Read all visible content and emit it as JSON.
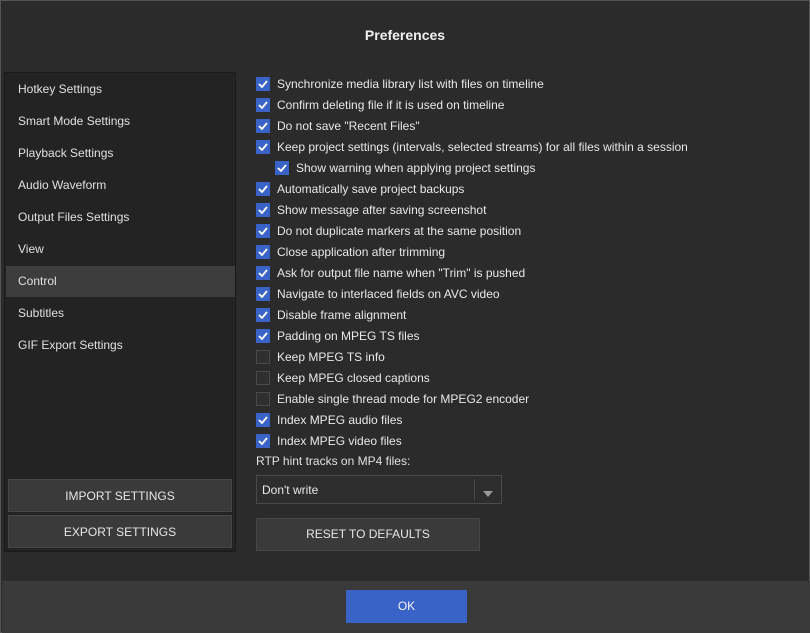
{
  "window": {
    "title": "Preferences"
  },
  "sidebar": {
    "items": [
      {
        "label": "Hotkey Settings"
      },
      {
        "label": "Smart Mode Settings"
      },
      {
        "label": "Playback Settings"
      },
      {
        "label": "Audio Waveform"
      },
      {
        "label": "Output Files Settings"
      },
      {
        "label": "View"
      },
      {
        "label": "Control",
        "active": true
      },
      {
        "label": "Subtitles"
      },
      {
        "label": "GIF Export Settings"
      }
    ],
    "import_label": "IMPORT SETTINGS",
    "export_label": "EXPORT SETTINGS"
  },
  "options": [
    {
      "label": "Synchronize media library list with files on timeline",
      "checked": true
    },
    {
      "label": "Confirm deleting file if it is used on timeline",
      "checked": true
    },
    {
      "label": "Do not save \"Recent Files\"",
      "checked": true
    },
    {
      "label": "Keep project settings (intervals, selected streams) for all files within a session",
      "checked": true
    },
    {
      "label": "Show warning when applying project settings",
      "checked": true,
      "indent": true
    },
    {
      "label": "Automatically save project backups",
      "checked": true
    },
    {
      "label": "Show message after saving screenshot",
      "checked": true
    },
    {
      "label": "Do not duplicate markers at the same position",
      "checked": true
    },
    {
      "label": "Close application after trimming",
      "checked": true
    },
    {
      "label": "Ask for output file name when \"Trim\" is pushed",
      "checked": true
    },
    {
      "label": "Navigate to interlaced fields on AVC video",
      "checked": true
    },
    {
      "label": "Disable frame alignment",
      "checked": true
    },
    {
      "label": "Padding on MPEG TS files",
      "checked": true
    },
    {
      "label": "Keep MPEG TS info",
      "checked": false
    },
    {
      "label": "Keep MPEG closed captions",
      "checked": false
    },
    {
      "label": "Enable single thread mode for MPEG2 encoder",
      "checked": false
    },
    {
      "label": "Index MPEG audio files",
      "checked": true
    },
    {
      "label": "Index MPEG video files",
      "checked": true
    }
  ],
  "rtp": {
    "label": "RTP hint tracks on MP4 files:",
    "selected": "Don't write"
  },
  "reset_label": "RESET TO DEFAULTS",
  "ok_label": "OK",
  "colors": {
    "accent": "#3a63c7",
    "background": "#2b2b2b",
    "sidebar_active": "#3d3d3d"
  }
}
